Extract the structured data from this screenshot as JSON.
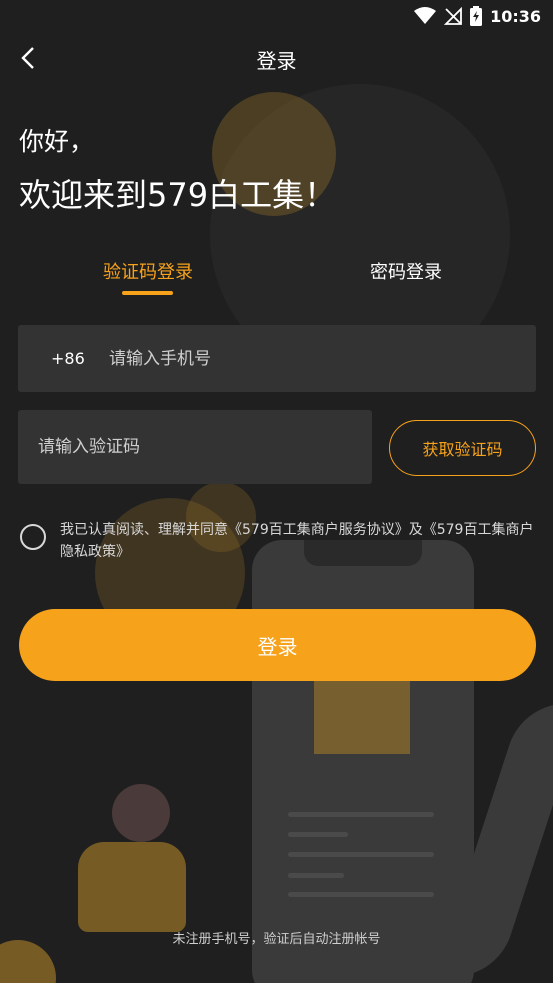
{
  "status_bar": {
    "time": "10:36"
  },
  "header": {
    "title": "登录"
  },
  "greeting": {
    "line1": "你好，",
    "line2": "欢迎来到579白工集！"
  },
  "tabs": [
    {
      "label": "验证码登录",
      "active": true
    },
    {
      "label": "密码登录",
      "active": false
    }
  ],
  "phone_field": {
    "country_code": "+86",
    "placeholder": "请输入手机号",
    "value": ""
  },
  "code_field": {
    "placeholder": "请输入验证码",
    "value": ""
  },
  "get_code_button": "获取验证码",
  "agreement": {
    "prefix": "我已认真阅读、理解并同意",
    "link1": "《579百工集商户服务协议》",
    "middle": "及",
    "link2": "《579百工集商户隐私政策》",
    "checked": false
  },
  "login_button": "登录",
  "footer_note": "未注册手机号，验证后自动注册帐号",
  "colors": {
    "accent": "#f7a21b",
    "background": "#1f1f1f",
    "field": "#333333"
  }
}
